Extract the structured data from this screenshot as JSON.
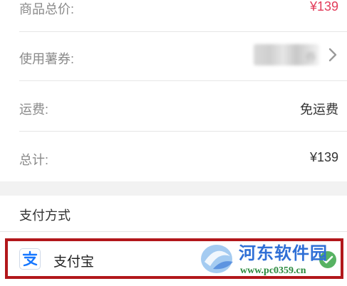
{
  "order_summary": {
    "goods_total_label": "商品总价:",
    "goods_total_value": "¥139",
    "coupon_label": "使用薯券:",
    "coupon_value": "券",
    "shipping_label": "运费:",
    "shipping_value": "免运费",
    "total_label": "总计:",
    "total_value": "¥139"
  },
  "payment": {
    "section_title": "支付方式",
    "method_label": "支付宝",
    "method_icon": "alipay-icon",
    "selected_icon": "check-circle-icon"
  },
  "watermark": {
    "brand": "河东软件园",
    "url": "www.pc0359.cn"
  },
  "colors": {
    "price_accent": "#e23b5a",
    "highlight_border": "#b2171b",
    "alipay_blue": "#1677ff",
    "watermark_blue": "#2f6fd6",
    "watermark_green": "#2b8a3e"
  }
}
